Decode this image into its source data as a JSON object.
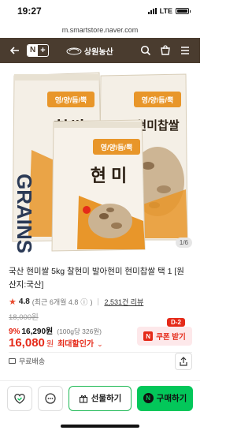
{
  "status": {
    "time": "19:27",
    "network": "LTE"
  },
  "browser": {
    "url": "m.smartstore.naver.com"
  },
  "header": {
    "brand_n": "N",
    "brand_plus": "+",
    "store_name": "상원농산"
  },
  "hero": {
    "pager": "1/6",
    "bags": [
      {
        "label": "찹쌀",
        "banner": "영/양/듬/뿍",
        "side": "GRAINS"
      },
      {
        "label": "현미찹쌀",
        "banner": "영/양/듬/뿍",
        "side": "GRAINS"
      },
      {
        "label": "현 미",
        "banner": "영/양/듬/뿍",
        "side": "GRAINS"
      }
    ]
  },
  "product": {
    "title": "국산 현미쌀 5kg 찰현미 발아현미 현미찹쌀 택 1 [원산지:국산]",
    "rating": "4.8",
    "rating_recent": "(최근 6개월 4.8",
    "rating_info_icon": "ⓘ",
    "rating_close": ")",
    "reviews": "2,531건 리뷰",
    "original_price": "18,000원",
    "discount_pct": "9%",
    "discount_price": "16,290원",
    "unit_price": "(100g당 326원)",
    "final_amount": "16,080",
    "final_won": "원",
    "final_label": "최대할인가",
    "final_chevron": "⌄",
    "coupon_badge": "N",
    "coupon_label": "쿠폰 받기",
    "d_badge": "D-2",
    "shipping": "무료배송"
  },
  "bottom": {
    "gift_label": "선물하기",
    "buy_badge": "N",
    "buy_label": "구매하기"
  },
  "colors": {
    "header_bg": "#4a3c2f",
    "accent_red": "#e52a19",
    "naver_green": "#03c75a",
    "bag_orange": "#e8962a"
  }
}
